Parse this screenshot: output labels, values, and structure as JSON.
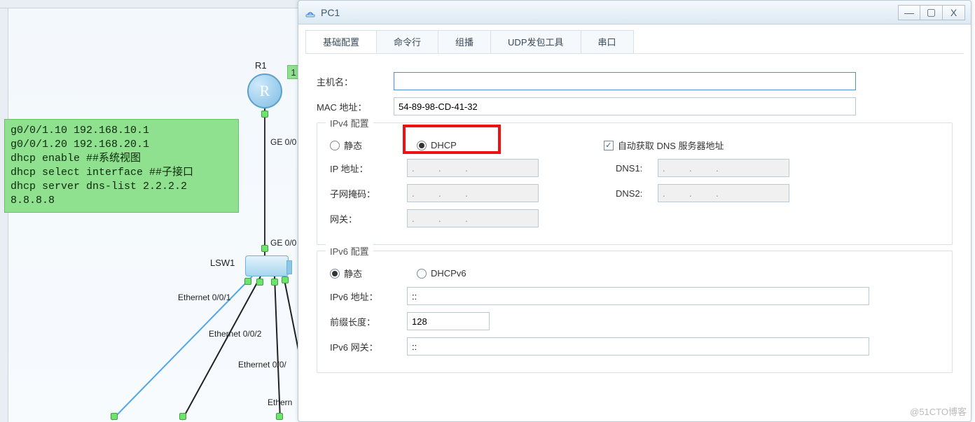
{
  "topology": {
    "router_label": "R1",
    "switch_label": "LSW1",
    "green_tag": "1",
    "port_ge_1": "GE 0/0",
    "port_ge_2": "GE 0/0",
    "port_eth_001": "Ethernet 0/0/1",
    "port_eth_002": "Ethernet 0/0/2",
    "port_eth_003": "Ethernet 0/0/",
    "port_eth_004": "Ethern",
    "note_text": "g0/0/1.10 192.168.10.1\ng0/0/1.20 192.168.20.1\ndhcp enable ##系统视图\ndhcp select interface ##子接口\ndhcp server dns-list 2.2.2.2\n8.8.8.8"
  },
  "window": {
    "title": "PC1",
    "tabs": [
      "基础配置",
      "命令行",
      "组播",
      "UDP发包工具",
      "串口"
    ],
    "active_tab": 0,
    "hostname_label": "主机名：",
    "hostname_value": "",
    "mac_label": "MAC 地址：",
    "mac_value": "54-89-98-CD-41-32",
    "ipv4": {
      "legend": "IPv4 配置",
      "static_label": "静态",
      "dhcp_label": "DHCP",
      "mode": "dhcp",
      "auto_dns_label": "自动获取 DNS 服务器地址",
      "auto_dns_checked": true,
      "ip_label": "IP 地址：",
      "ip_value": ".    .    .",
      "mask_label": "子网掩码：",
      "mask_value": ".    .    .",
      "gw_label": "网关：",
      "gw_value": ".    .    .",
      "dns1_label": "DNS1:",
      "dns1_value": ".    .    .",
      "dns2_label": "DNS2:",
      "dns2_value": ".    .    ."
    },
    "ipv6": {
      "legend": "IPv6 配置",
      "static_label": "静态",
      "dhcpv6_label": "DHCPv6",
      "mode": "static",
      "addr_label": "IPv6 地址：",
      "addr_value": "::",
      "prefix_label": "前缀长度：",
      "prefix_value": "128",
      "gw_label": "IPv6 网关：",
      "gw_value": "::"
    }
  },
  "controls": {
    "min": "—",
    "max": "▢",
    "close": "X"
  },
  "watermark": "@51CTO博客"
}
